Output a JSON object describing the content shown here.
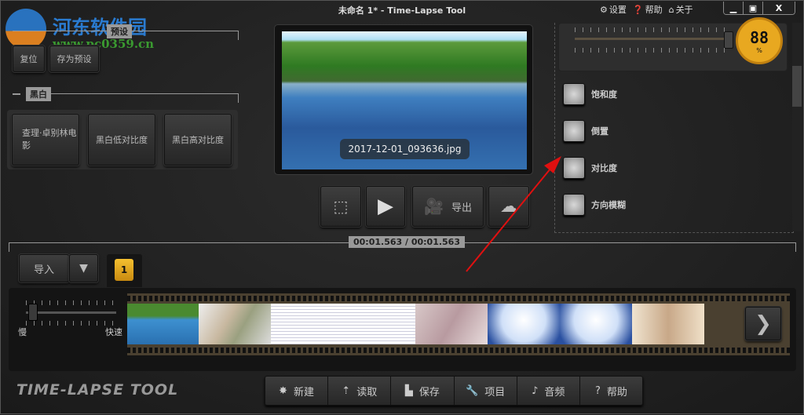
{
  "window": {
    "title": "未命名 1* - Time-Lapse Tool",
    "links": [
      "设置",
      "帮助",
      "关于"
    ],
    "controls": [
      "minimize",
      "maximize",
      "close"
    ]
  },
  "watermark": {
    "name": "河东软件园",
    "url": "www.pc0359.cn"
  },
  "presets": {
    "section_label": "预设",
    "reset": "复位",
    "save_preset": "存为预设"
  },
  "bw": {
    "section_label": "黑白",
    "buttons": [
      "查理·卓别林电影",
      "黑白低对比度",
      "黑白高对比度"
    ]
  },
  "preview": {
    "filename": "2017-12-01_093636.jpg"
  },
  "effects": {
    "gauge_value": "88",
    "gauge_unit": "%",
    "items": [
      "饱和度",
      "倒置",
      "对比度",
      "方向模糊"
    ]
  },
  "transport": {
    "export": "导出"
  },
  "timecode": "00:01.563 / 00:01.563",
  "import": {
    "label": "导入"
  },
  "tab": {
    "number": "1"
  },
  "speed": {
    "slow": "慢",
    "fast": "快速"
  },
  "logo": "TIME-LAPSE TOOL",
  "toolbar": [
    "新建",
    "读取",
    "保存",
    "项目",
    "音频",
    "帮助"
  ],
  "colors": {
    "accent": "#f0b020",
    "annotation": "#e01010"
  }
}
